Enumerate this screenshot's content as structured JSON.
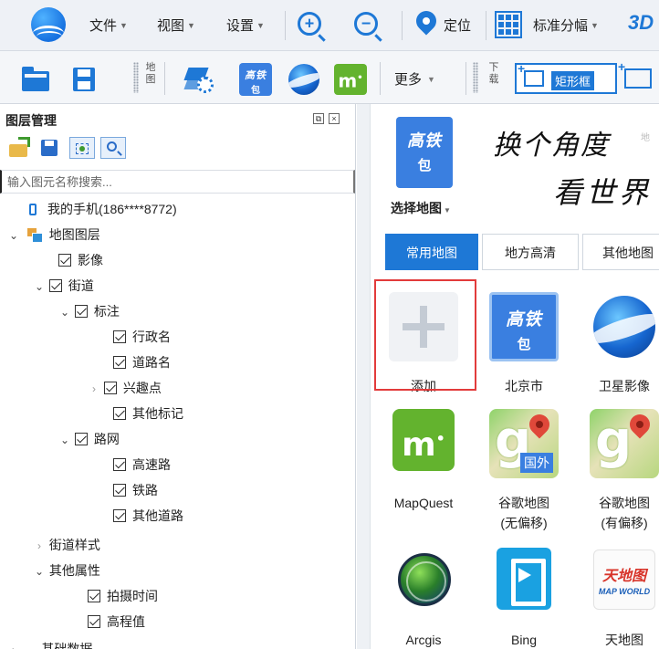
{
  "menubar": {
    "items": [
      {
        "label": "文件"
      },
      {
        "label": "视图"
      },
      {
        "label": "设置"
      }
    ],
    "locate_label": "定位",
    "standard_sheet_label": "标准分幅",
    "three_d_label": "3D"
  },
  "toolbar": {
    "map_label": "地图",
    "download_label": "下载",
    "gaotie_line1": "高铁",
    "gaotie_line2": "包",
    "mq_label": "m",
    "more_label": "更多",
    "rect_label": "矩形框"
  },
  "layer_panel": {
    "title": "图层管理",
    "search_placeholder": "输入图元名称搜索...",
    "tree": [
      {
        "label": "我的手机(186****8772)"
      },
      {
        "label": "地图图层"
      },
      {
        "label": "影像"
      },
      {
        "label": "街道"
      },
      {
        "label": "标注"
      },
      {
        "label": "行政名"
      },
      {
        "label": "道路名"
      },
      {
        "label": "兴趣点"
      },
      {
        "label": "其他标记"
      },
      {
        "label": "路网"
      },
      {
        "label": "高速路"
      },
      {
        "label": "铁路"
      },
      {
        "label": "其他道路"
      },
      {
        "label": "街道样式"
      },
      {
        "label": "其他属性"
      },
      {
        "label": "拍摄时间"
      },
      {
        "label": "高程值"
      },
      {
        "label": "基础数据"
      }
    ]
  },
  "map_panel": {
    "selected_line1": "高铁",
    "selected_line2": "包",
    "choose_label": "选择地图",
    "slogan_line1": "换个角度",
    "slogan_line2": "看世界",
    "ghost_tab": "地",
    "tabs": [
      {
        "label": "常用地图"
      },
      {
        "label": "地方高清"
      },
      {
        "label": "其他地图"
      }
    ],
    "tiles": [
      {
        "name": "添加"
      },
      {
        "name": "北京市"
      },
      {
        "name": "卫星影像"
      },
      {
        "name": "MapQuest"
      },
      {
        "name": "谷歌地图\n(无偏移)",
        "line1": "谷歌地图",
        "line2": "(无偏移)"
      },
      {
        "name": "谷歌地图\n(有偏移)",
        "line1": "谷歌地图",
        "line2": "(有偏移)"
      },
      {
        "name": "Arcgis"
      },
      {
        "name": "Bing"
      },
      {
        "name": "天地图"
      }
    ],
    "foreign_tag": "国外",
    "tdt_logo_cn": "天地图",
    "tdt_logo_en": "MAP WORLD"
  },
  "colors": {
    "accent": "#1e78d6",
    "highlight": "#e23b3b",
    "mq_green": "#63b32e"
  }
}
